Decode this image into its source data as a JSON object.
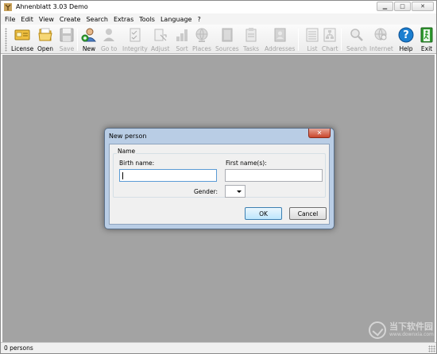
{
  "window": {
    "title": "Ahnenblatt 3.03 Demo"
  },
  "menu": [
    "File",
    "Edit",
    "View",
    "Create",
    "Search",
    "Extras",
    "Tools",
    "Language",
    "?"
  ],
  "toolbar": {
    "license": "License",
    "open": "Open",
    "save": "Save",
    "new": "New",
    "goto": "Go to",
    "integrity": "Integrity",
    "adjust": "Adjust",
    "sort": "Sort",
    "places": "Places",
    "sources": "Sources",
    "tasks": "Tasks",
    "addresses": "Addresses",
    "list": "List",
    "chart": "Chart",
    "search": "Search",
    "internet": "Internet",
    "help": "Help",
    "exit": "Exit",
    "help_glyph": "?"
  },
  "dialog": {
    "title": "New person",
    "close_glyph": "✕",
    "group_title": "Name",
    "birth_name_label": "Birth name:",
    "birth_name_value": "",
    "first_names_label": "First name(s):",
    "first_names_value": "",
    "gender_label": "Gender:",
    "gender_value": "",
    "ok": "OK",
    "cancel": "Cancel"
  },
  "status": {
    "text": "0 persons"
  },
  "watermark": {
    "cn": "当下软件园",
    "url": "www.downxia.com"
  },
  "colors": {
    "workspace": "#a3a3a3",
    "dialog_frame": "#b9cde5",
    "help_blue": "#1c7fd0",
    "exit_green": "#2f9a2f",
    "close_red": "#c9462c"
  }
}
